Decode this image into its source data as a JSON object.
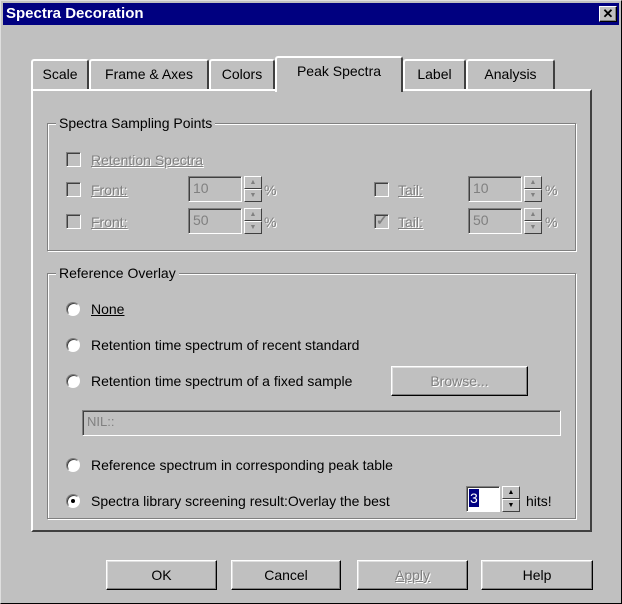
{
  "window": {
    "title": "Spectra Decoration",
    "close_glyph": "✕"
  },
  "tabs": [
    {
      "label": "Scale"
    },
    {
      "label": "Frame & Axes"
    },
    {
      "label": "Colors"
    },
    {
      "label": "Peak Spectra",
      "active": true
    },
    {
      "label": "Label"
    },
    {
      "label": "Analysis"
    }
  ],
  "sampling": {
    "legend": "Spectra Sampling Points",
    "retention_label": "Retention Spectra",
    "row1": {
      "left_label": "Front:",
      "left_value": "10",
      "left_unit": "%",
      "right_label": "Tail:",
      "right_value": "10",
      "right_unit": "%",
      "right_checked": false
    },
    "row2": {
      "left_label": "Front:",
      "left_value": "50",
      "left_unit": "%",
      "right_label": "Tail:",
      "right_value": "50",
      "right_unit": "%",
      "right_checked": true
    }
  },
  "overlay": {
    "legend": "Reference Overlay",
    "opt_none": "None",
    "opt_recent_standard": "Retention time spectrum of recent standard",
    "opt_fixed_sample": "Retention time spectrum of a fixed sample",
    "browse_label": "Browse...",
    "fixed_sample_path": "NIL::",
    "opt_peak_table": "Reference spectrum in corresponding peak table",
    "opt_library": "Spectra library screening result:Overlay the best",
    "best_hits_value": "3",
    "hits_suffix": "hits!",
    "selected": "library"
  },
  "buttons": {
    "ok": "OK",
    "cancel": "Cancel",
    "apply": "Apply",
    "help": "Help"
  },
  "colors": {
    "titlebar": "#000080",
    "face": "#c0c0c0",
    "disabled_text": "#808080"
  },
  "icons": {
    "close": "close-icon",
    "spin_up": "arrow-up-icon",
    "spin_down": "arrow-down-icon",
    "check": "check-icon"
  }
}
